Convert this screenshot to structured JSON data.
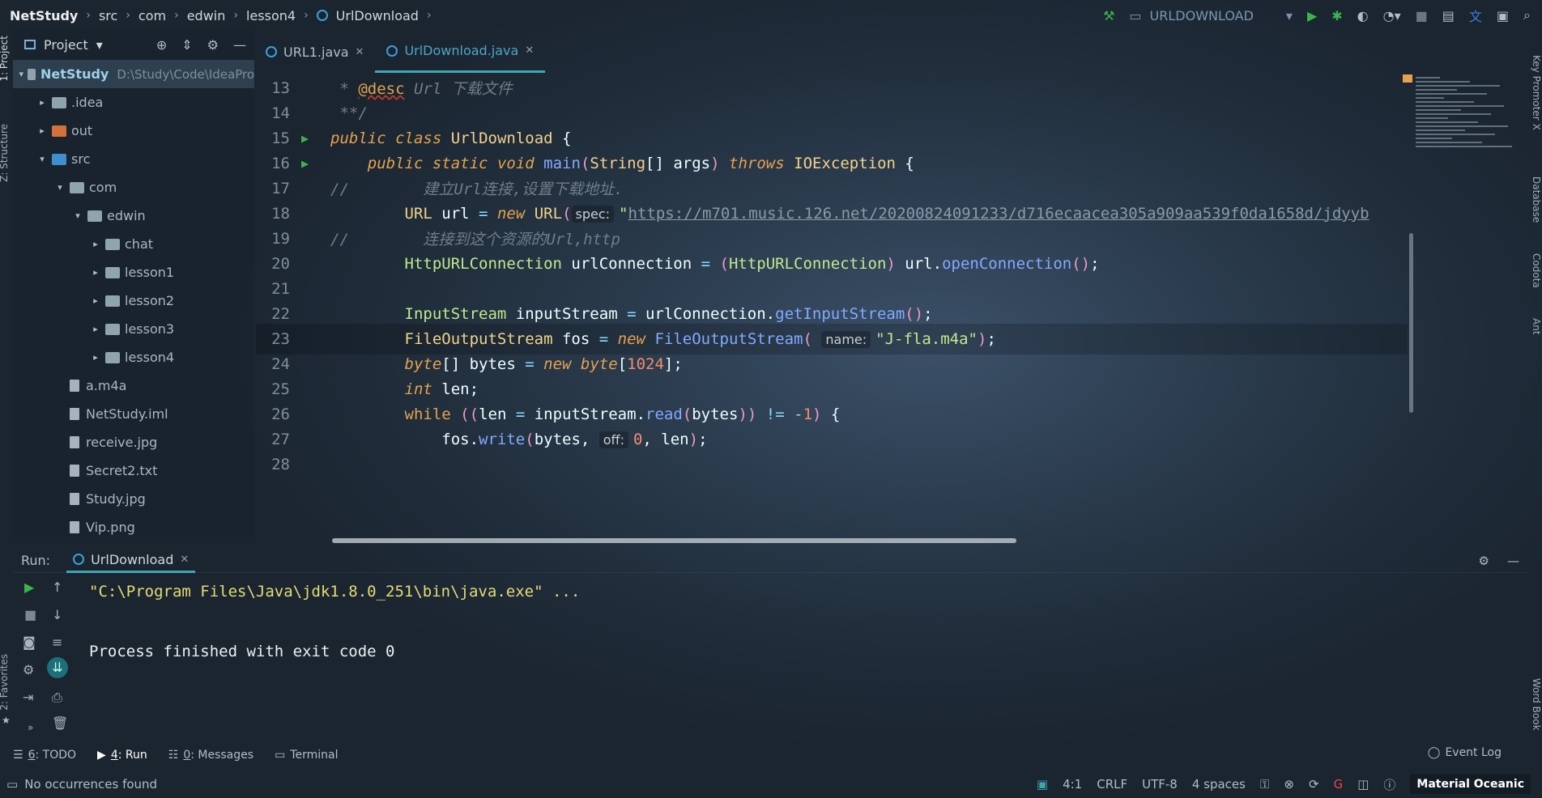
{
  "breadcrumb": {
    "project": "NetStudy",
    "items": [
      "src",
      "com",
      "edwin",
      "lesson4"
    ],
    "file": "UrlDownload"
  },
  "toolbar": {
    "run_config": "URLDOWNLOAD"
  },
  "left_strip": {
    "project": "1: Project",
    "structure": "Z: Structure",
    "favorites": "2: Favorites"
  },
  "right_strip": {
    "key_promoter": "Key Promoter X",
    "database": "Database",
    "codota": "Codota",
    "ant": "Ant",
    "word_book": "Word Book"
  },
  "project_panel": {
    "title": "Project",
    "tree": [
      {
        "label": "NetStudy",
        "path": "D:\\Study\\Code\\IdeaPro",
        "depth": 0,
        "arrow": "▾",
        "icon": "gr",
        "selected": true
      },
      {
        "label": ".idea",
        "depth": 1,
        "arrow": "▸",
        "icon": "gr"
      },
      {
        "label": "out",
        "depth": 1,
        "arrow": "▸",
        "icon": "org"
      },
      {
        "label": "src",
        "depth": 1,
        "arrow": "▾",
        "icon": "blue"
      },
      {
        "label": "com",
        "depth": 2,
        "arrow": "▾",
        "icon": "gr"
      },
      {
        "label": "edwin",
        "depth": 3,
        "arrow": "▾",
        "icon": "gr"
      },
      {
        "label": "chat",
        "depth": 4,
        "arrow": "▸",
        "icon": "gr"
      },
      {
        "label": "lesson1",
        "depth": 4,
        "arrow": "▸",
        "icon": "gr"
      },
      {
        "label": "lesson2",
        "depth": 4,
        "arrow": "▸",
        "icon": "gr"
      },
      {
        "label": "lesson3",
        "depth": 4,
        "arrow": "▸",
        "icon": "gr"
      },
      {
        "label": "lesson4",
        "depth": 4,
        "arrow": "▸",
        "icon": "gr"
      },
      {
        "label": "a.m4a",
        "depth": 2,
        "arrow": "",
        "icon": "file"
      },
      {
        "label": "NetStudy.iml",
        "depth": 2,
        "arrow": "",
        "icon": "file"
      },
      {
        "label": "receive.jpg",
        "depth": 2,
        "arrow": "",
        "icon": "file"
      },
      {
        "label": "Secret2.txt",
        "depth": 2,
        "arrow": "",
        "icon": "file"
      },
      {
        "label": "Study.jpg",
        "depth": 2,
        "arrow": "",
        "icon": "file"
      },
      {
        "label": "Vip.png",
        "depth": 2,
        "arrow": "",
        "icon": "file"
      }
    ]
  },
  "tabs": [
    {
      "label": "URL1.java",
      "active": false
    },
    {
      "label": "UrlDownload.java",
      "active": true
    }
  ],
  "editor": {
    "current_line": 23,
    "lines": [
      {
        "n": "13",
        "tokens": [
          [
            "cm",
            " * "
          ],
          [
            "ann",
            "@desc"
          ],
          [
            "cm",
            " Url 下载文件"
          ]
        ]
      },
      {
        "n": "14",
        "tokens": [
          [
            "cm",
            " **/"
          ]
        ]
      },
      {
        "n": "15",
        "run": true,
        "tokens": [
          [
            "kw",
            "public"
          ],
          [
            "var",
            " "
          ],
          [
            "kw",
            "class"
          ],
          [
            "var",
            " "
          ],
          [
            "cls",
            "UrlDownload"
          ],
          [
            "var",
            " {"
          ]
        ]
      },
      {
        "n": "16",
        "run": true,
        "tokens": [
          [
            "var",
            "    "
          ],
          [
            "kw",
            "public"
          ],
          [
            "var",
            " "
          ],
          [
            "kw",
            "static"
          ],
          [
            "var",
            " "
          ],
          [
            "kw",
            "void"
          ],
          [
            "var",
            " "
          ],
          [
            "fn",
            "main"
          ],
          [
            "par",
            "("
          ],
          [
            "cls",
            "String"
          ],
          [
            "var",
            "[] "
          ],
          [
            "var",
            "args"
          ],
          [
            "par",
            ")"
          ],
          [
            "var",
            " "
          ],
          [
            "kw",
            "throws"
          ],
          [
            "var",
            " "
          ],
          [
            "cls",
            "IOException"
          ],
          [
            "var",
            " {"
          ]
        ]
      },
      {
        "n": "17",
        "tokens": [
          [
            "cm",
            "//        建立Url连接,设置下载地址."
          ]
        ]
      },
      {
        "n": "18",
        "tokens": [
          [
            "var",
            "        "
          ],
          [
            "cls",
            "URL"
          ],
          [
            "var",
            " url "
          ],
          [
            "op",
            "="
          ],
          [
            "var",
            " "
          ],
          [
            "kw",
            "new"
          ],
          [
            "var",
            " "
          ],
          [
            "cls",
            "URL"
          ],
          [
            "par",
            "("
          ],
          [
            "hint",
            "spec:"
          ],
          [
            "str",
            "\""
          ],
          [
            "url",
            "https://m701.music.126.net/20200824091233/d716ecaacea305a909aa539f0da1658d/jdyyb"
          ]
        ]
      },
      {
        "n": "19",
        "tokens": [
          [
            "cm",
            "//        连接到这个资源的Url,http"
          ]
        ]
      },
      {
        "n": "20",
        "tokens": [
          [
            "var",
            "        "
          ],
          [
            "ty",
            "HttpURLConnection"
          ],
          [
            "var",
            " urlConnection "
          ],
          [
            "op",
            "="
          ],
          [
            "var",
            " "
          ],
          [
            "par",
            "("
          ],
          [
            "ty",
            "HttpURLConnection"
          ],
          [
            "par",
            ")"
          ],
          [
            "var",
            " url."
          ],
          [
            "fn",
            "openConnection"
          ],
          [
            "par",
            "()"
          ],
          [
            "var",
            ";"
          ]
        ]
      },
      {
        "n": "21",
        "tokens": []
      },
      {
        "n": "22",
        "tokens": [
          [
            "var",
            "        "
          ],
          [
            "ty",
            "InputStream"
          ],
          [
            "var",
            " inputStream "
          ],
          [
            "op",
            "="
          ],
          [
            "var",
            " urlConnection."
          ],
          [
            "fn",
            "getInputStream"
          ],
          [
            "par",
            "()"
          ],
          [
            "var",
            ";"
          ]
        ]
      },
      {
        "n": "23",
        "tokens": [
          [
            "var",
            "        "
          ],
          [
            "cls",
            "FileOutputStream"
          ],
          [
            "var",
            " fos "
          ],
          [
            "op",
            "="
          ],
          [
            "var",
            " "
          ],
          [
            "kw",
            "new"
          ],
          [
            "var",
            " "
          ],
          [
            "fn",
            "FileOutputStream"
          ],
          [
            "par",
            "("
          ],
          [
            "var",
            " "
          ],
          [
            "hint",
            "name:"
          ],
          [
            "str",
            "\"J-fla.m4a\""
          ],
          [
            "par",
            ")"
          ],
          [
            "var",
            ";"
          ]
        ]
      },
      {
        "n": "24",
        "tokens": [
          [
            "var",
            "        "
          ],
          [
            "kw",
            "byte"
          ],
          [
            "var",
            "[] bytes "
          ],
          [
            "op",
            "="
          ],
          [
            "var",
            " "
          ],
          [
            "kw",
            "new"
          ],
          [
            "var",
            " "
          ],
          [
            "kw",
            "byte"
          ],
          [
            "var",
            "["
          ],
          [
            "num",
            "1024"
          ],
          [
            "var",
            "];"
          ]
        ]
      },
      {
        "n": "25",
        "tokens": [
          [
            "var",
            "        "
          ],
          [
            "kw",
            "int"
          ],
          [
            "var",
            " "
          ],
          [
            "var",
            "len"
          ],
          [
            "var",
            ";"
          ]
        ]
      },
      {
        "n": "26",
        "tokens": [
          [
            "var",
            "        "
          ],
          [
            "kwn",
            "while"
          ],
          [
            "var",
            " "
          ],
          [
            "par",
            "(("
          ],
          [
            "var",
            "len"
          ],
          [
            "var",
            " "
          ],
          [
            "op",
            "="
          ],
          [
            "var",
            " inputStream."
          ],
          [
            "fn",
            "read"
          ],
          [
            "par",
            "("
          ],
          [
            "var",
            "bytes"
          ],
          [
            "par",
            "))"
          ],
          [
            "var",
            " "
          ],
          [
            "op",
            "!="
          ],
          [
            "var",
            " "
          ],
          [
            "op",
            "-"
          ],
          [
            "num",
            "1"
          ],
          [
            "par",
            ")"
          ],
          [
            "var",
            " {"
          ]
        ]
      },
      {
        "n": "27",
        "tokens": [
          [
            "var",
            "            fos."
          ],
          [
            "fn",
            "write"
          ],
          [
            "par",
            "("
          ],
          [
            "var",
            "bytes, "
          ],
          [
            "hint",
            "off:"
          ],
          [
            "num",
            "0"
          ],
          [
            "var",
            ", len"
          ],
          [
            "par",
            ")"
          ],
          [
            "var",
            ";"
          ]
        ]
      },
      {
        "n": "28",
        "tokens": []
      }
    ]
  },
  "run_panel": {
    "label": "Run:",
    "tab": "UrlDownload",
    "console": [
      "\"C:\\Program Files\\Java\\jdk1.8.0_251\\bin\\java.exe\" ...",
      "",
      "Process finished with exit code 0"
    ]
  },
  "bottom_tabs": [
    {
      "key": "6",
      "label": ": TODO"
    },
    {
      "key": "4",
      "label": ": Run"
    },
    {
      "key": "0",
      "label": ": Messages"
    },
    {
      "key": "",
      "label": "Terminal"
    }
  ],
  "event_log": "Event Log",
  "status_bar": {
    "message": "No occurrences found",
    "position": "4:1",
    "line_sep": "CRLF",
    "encoding": "UTF-8",
    "indent": "4 spaces",
    "theme": "Material Oceanic"
  }
}
